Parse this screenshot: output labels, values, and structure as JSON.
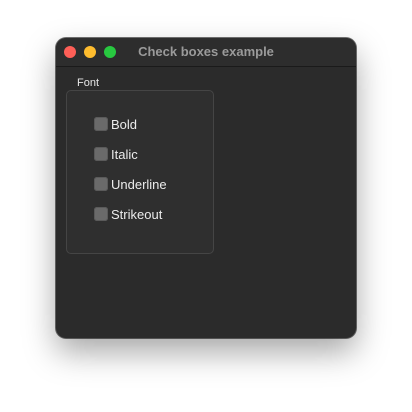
{
  "window": {
    "title": "Check boxes example",
    "traffic_lights": {
      "close_color": "#fe5f57",
      "minimize_color": "#febc2e",
      "zoom_color": "#28c840"
    }
  },
  "group": {
    "title": "Font",
    "checkboxes": [
      {
        "label": "Bold",
        "checked": false
      },
      {
        "label": "Italic",
        "checked": false
      },
      {
        "label": "Underline",
        "checked": false
      },
      {
        "label": "Strikeout",
        "checked": false
      }
    ]
  },
  "colors": {
    "window_bg": "#2b2b2b",
    "text": "#ececec",
    "title_text": "#9a9a9a"
  }
}
